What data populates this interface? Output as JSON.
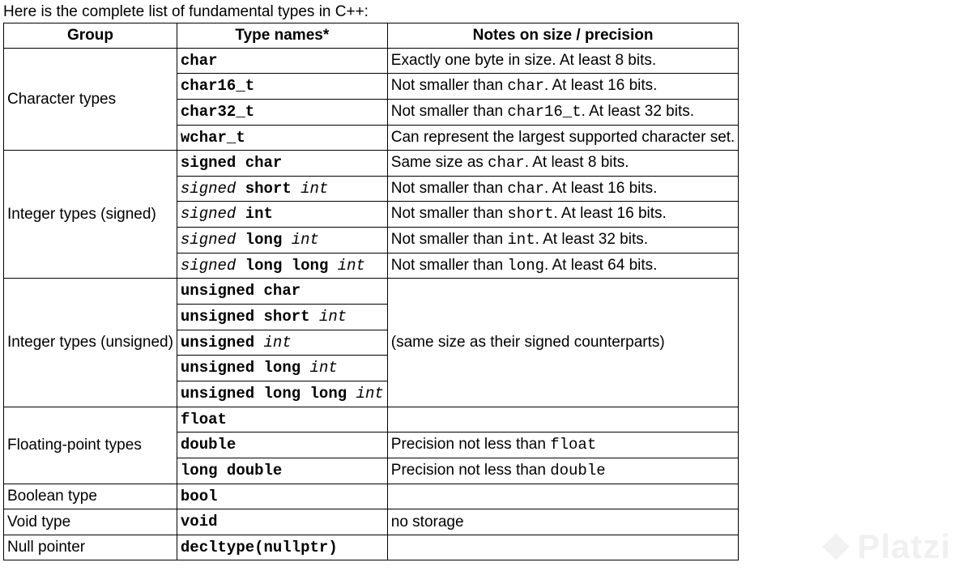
{
  "intro": "Here is the complete list of fundamental types in C++:",
  "headers": {
    "group": "Group",
    "typenames": "Type names*",
    "notes": "Notes on size / precision"
  },
  "sections": [
    {
      "group": "Character types",
      "rows": [
        {
          "type_parts": [
            {
              "t": "char",
              "b": true,
              "i": false
            }
          ],
          "note_parts": [
            {
              "t": "Exactly one byte in size. At least 8 bits.",
              "c": false
            }
          ]
        },
        {
          "type_parts": [
            {
              "t": "char16_t",
              "b": true,
              "i": false
            }
          ],
          "note_parts": [
            {
              "t": "Not smaller than ",
              "c": false
            },
            {
              "t": "char",
              "c": true
            },
            {
              "t": ". At least 16 bits.",
              "c": false
            }
          ]
        },
        {
          "type_parts": [
            {
              "t": "char32_t",
              "b": true,
              "i": false
            }
          ],
          "note_parts": [
            {
              "t": "Not smaller than ",
              "c": false
            },
            {
              "t": "char16_t",
              "c": true
            },
            {
              "t": ". At least 32 bits.",
              "c": false
            }
          ]
        },
        {
          "type_parts": [
            {
              "t": "wchar_t",
              "b": true,
              "i": false
            }
          ],
          "note_parts": [
            {
              "t": "Can represent the largest supported character set.",
              "c": false
            }
          ]
        }
      ]
    },
    {
      "group": "Integer types (signed)",
      "rows": [
        {
          "type_parts": [
            {
              "t": "signed char",
              "b": true,
              "i": false
            }
          ],
          "note_parts": [
            {
              "t": "Same size as ",
              "c": false
            },
            {
              "t": "char",
              "c": true
            },
            {
              "t": ". At least 8 bits.",
              "c": false
            }
          ]
        },
        {
          "type_parts": [
            {
              "t": "signed",
              "b": false,
              "i": true
            },
            {
              "t": " ",
              "b": false,
              "i": false
            },
            {
              "t": "short",
              "b": true,
              "i": false
            },
            {
              "t": " ",
              "b": false,
              "i": false
            },
            {
              "t": "int",
              "b": false,
              "i": true
            }
          ],
          "note_parts": [
            {
              "t": "Not smaller than ",
              "c": false
            },
            {
              "t": "char",
              "c": true
            },
            {
              "t": ". At least 16 bits.",
              "c": false
            }
          ]
        },
        {
          "type_parts": [
            {
              "t": "signed",
              "b": false,
              "i": true
            },
            {
              "t": " ",
              "b": false,
              "i": false
            },
            {
              "t": "int",
              "b": true,
              "i": false
            }
          ],
          "note_parts": [
            {
              "t": "Not smaller than ",
              "c": false
            },
            {
              "t": "short",
              "c": true
            },
            {
              "t": ". At least 16 bits.",
              "c": false
            }
          ]
        },
        {
          "type_parts": [
            {
              "t": "signed",
              "b": false,
              "i": true
            },
            {
              "t": " ",
              "b": false,
              "i": false
            },
            {
              "t": "long",
              "b": true,
              "i": false
            },
            {
              "t": " ",
              "b": false,
              "i": false
            },
            {
              "t": "int",
              "b": false,
              "i": true
            }
          ],
          "note_parts": [
            {
              "t": "Not smaller than ",
              "c": false
            },
            {
              "t": "int",
              "c": true
            },
            {
              "t": ". At least 32 bits.",
              "c": false
            }
          ]
        },
        {
          "type_parts": [
            {
              "t": "signed",
              "b": false,
              "i": true
            },
            {
              "t": " ",
              "b": false,
              "i": false
            },
            {
              "t": "long long",
              "b": true,
              "i": false
            },
            {
              "t": " ",
              "b": false,
              "i": false
            },
            {
              "t": "int",
              "b": false,
              "i": true
            }
          ],
          "note_parts": [
            {
              "t": "Not smaller than ",
              "c": false
            },
            {
              "t": "long",
              "c": true
            },
            {
              "t": ". At least 64 bits.",
              "c": false
            }
          ]
        }
      ]
    },
    {
      "group": "Integer types (unsigned)",
      "shared_note_parts": [
        {
          "t": "(same size as their signed counterparts)",
          "c": false
        }
      ],
      "rows": [
        {
          "type_parts": [
            {
              "t": "unsigned char",
              "b": true,
              "i": false
            }
          ]
        },
        {
          "type_parts": [
            {
              "t": "unsigned short",
              "b": true,
              "i": false
            },
            {
              "t": " ",
              "b": false,
              "i": false
            },
            {
              "t": "int",
              "b": false,
              "i": true
            }
          ]
        },
        {
          "type_parts": [
            {
              "t": "unsigned",
              "b": true,
              "i": false
            },
            {
              "t": " ",
              "b": false,
              "i": false
            },
            {
              "t": "int",
              "b": false,
              "i": true
            }
          ]
        },
        {
          "type_parts": [
            {
              "t": "unsigned long",
              "b": true,
              "i": false
            },
            {
              "t": " ",
              "b": false,
              "i": false
            },
            {
              "t": "int",
              "b": false,
              "i": true
            }
          ]
        },
        {
          "type_parts": [
            {
              "t": "unsigned long long",
              "b": true,
              "i": false
            },
            {
              "t": " ",
              "b": false,
              "i": false
            },
            {
              "t": "int",
              "b": false,
              "i": true
            }
          ]
        }
      ]
    },
    {
      "group": "Floating-point types",
      "rows": [
        {
          "type_parts": [
            {
              "t": "float",
              "b": true,
              "i": false
            }
          ],
          "note_parts": [
            {
              "t": "",
              "c": false
            }
          ]
        },
        {
          "type_parts": [
            {
              "t": "double",
              "b": true,
              "i": false
            }
          ],
          "note_parts": [
            {
              "t": "Precision not less than ",
              "c": false
            },
            {
              "t": "float",
              "c": true
            }
          ]
        },
        {
          "type_parts": [
            {
              "t": "long double",
              "b": true,
              "i": false
            }
          ],
          "note_parts": [
            {
              "t": "Precision not less than ",
              "c": false
            },
            {
              "t": "double",
              "c": true
            }
          ]
        }
      ]
    },
    {
      "group": "Boolean type",
      "rows": [
        {
          "type_parts": [
            {
              "t": "bool",
              "b": true,
              "i": false
            }
          ],
          "note_parts": [
            {
              "t": "",
              "c": false
            }
          ]
        }
      ]
    },
    {
      "group": "Void type",
      "rows": [
        {
          "type_parts": [
            {
              "t": "void",
              "b": true,
              "i": false
            }
          ],
          "note_parts": [
            {
              "t": "no storage",
              "c": false
            }
          ]
        }
      ]
    },
    {
      "group": "Null pointer",
      "rows": [
        {
          "type_parts": [
            {
              "t": "decltype(nullptr)",
              "b": true,
              "i": false
            }
          ],
          "note_parts": [
            {
              "t": "",
              "c": false
            }
          ]
        }
      ]
    }
  ],
  "watermark": "Platzi"
}
